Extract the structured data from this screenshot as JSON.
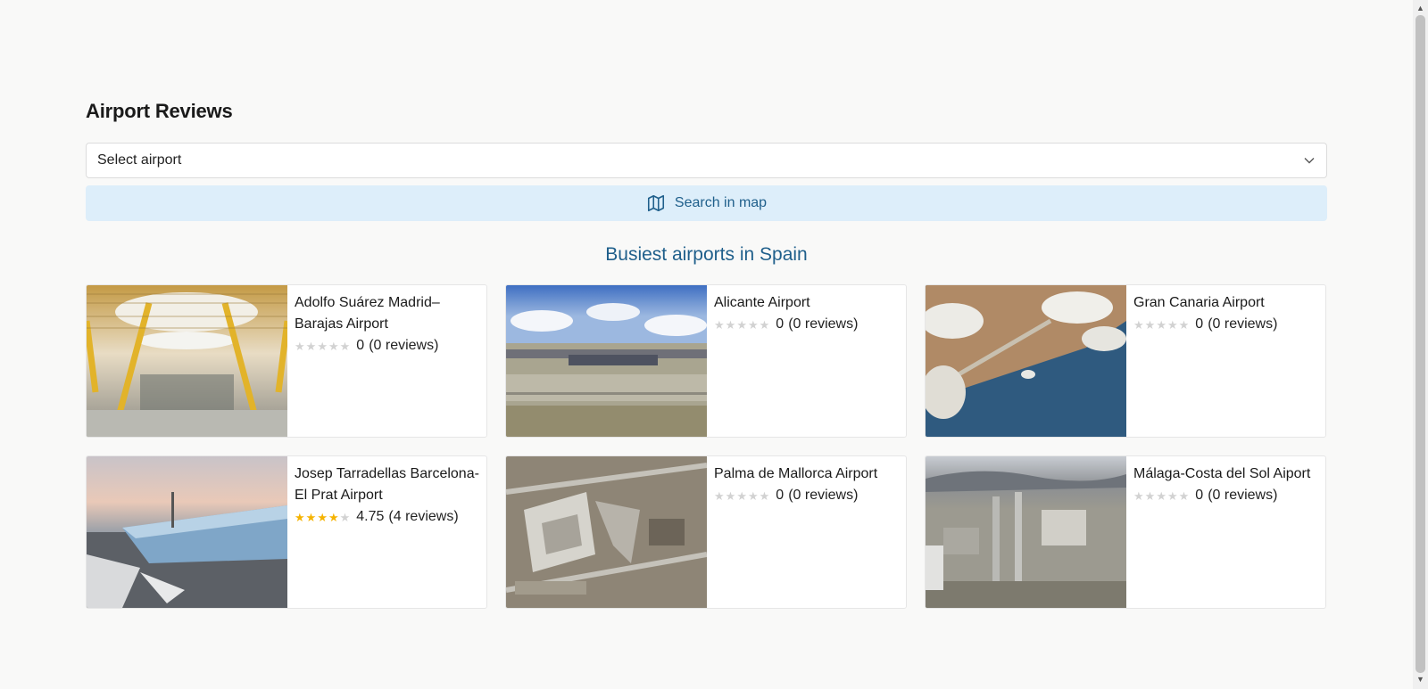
{
  "page": {
    "title": "Airport Reviews",
    "select": {
      "value": "Select airport"
    },
    "map_button": {
      "label": "Search in map"
    },
    "section_title": "Busiest airports in Spain"
  },
  "airports": [
    {
      "name": "Adolfo Suárez Madrid–Barajas Airport",
      "rating": 0,
      "score": "0",
      "reviews": "(0 reviews)",
      "image": "madrid-terminal-interior"
    },
    {
      "name": "Alicante Airport",
      "rating": 0,
      "score": "0",
      "reviews": "(0 reviews)",
      "image": "alicante-airfield"
    },
    {
      "name": "Gran Canaria Airport",
      "rating": 0,
      "score": "0",
      "reviews": "(0 reviews)",
      "image": "gran-canaria-aerial"
    },
    {
      "name": "Josep Tarradellas Barcelona-El Prat Airport",
      "rating": 4.75,
      "score": "4.75",
      "reviews": "(4 reviews)",
      "image": "barcelona-terminal"
    },
    {
      "name": "Palma de Mallorca Airport",
      "rating": 0,
      "score": "0",
      "reviews": "(0 reviews)",
      "image": "palma-aerial"
    },
    {
      "name": "Málaga-Costa del Sol Aiport",
      "rating": 0,
      "score": "0",
      "reviews": "(0 reviews)",
      "image": "malaga-aerial"
    }
  ],
  "colors": {
    "accent": "#1f5f8b",
    "star_on": "#f5b301",
    "star_off": "#d2d2d2",
    "map_button_bg": "#ddeefa"
  },
  "icons": {
    "select": "chevron-down-icon",
    "map_button": "map-icon",
    "star": "star-icon"
  }
}
